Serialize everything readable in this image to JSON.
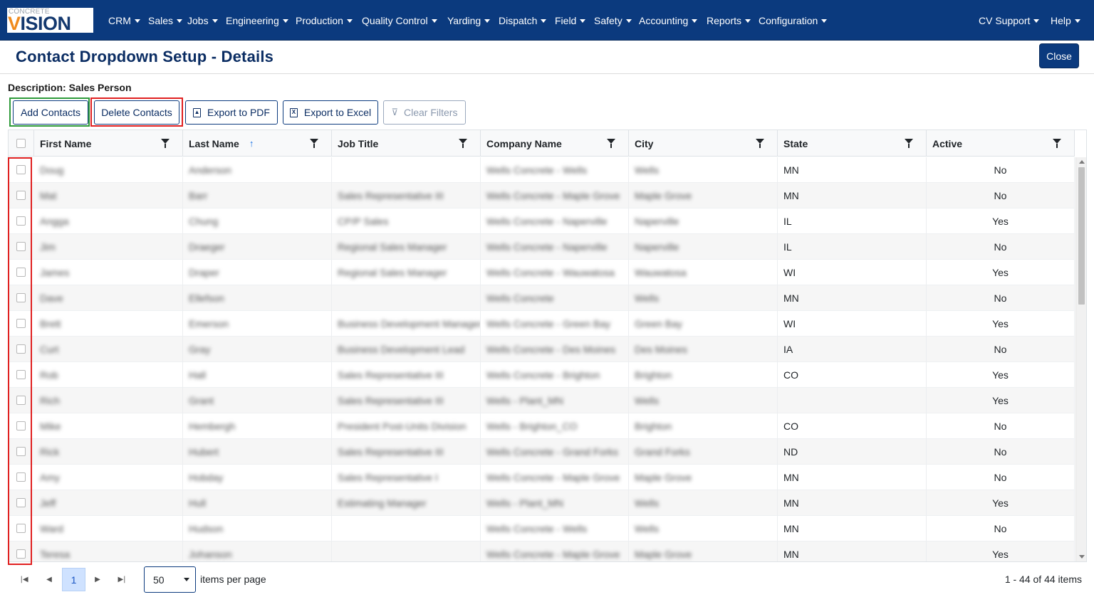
{
  "app": {
    "logo_top": "CONCRETE",
    "logo_brand": "VISION",
    "logo_brand_lead": "V",
    "logo_brand_rest": "ISION"
  },
  "nav": {
    "items": [
      "CRM",
      "Sales",
      "Jobs",
      "Engineering",
      "Production",
      "Quality Control",
      "Yarding",
      "Dispatch",
      "Field",
      "Safety",
      "Accounting",
      "Reports",
      "Configuration"
    ],
    "right_items": [
      "CV Support",
      "Help"
    ]
  },
  "page": {
    "title": "Contact Dropdown Setup - Details",
    "close_label": "Close",
    "description": "Description: Sales Person"
  },
  "toolbar": {
    "add_label": "Add Contacts",
    "delete_label": "Delete Contacts",
    "pdf_label": "Export to PDF",
    "excel_label": "Export to Excel",
    "clear_label": "Clear Filters"
  },
  "grid": {
    "columns": [
      "First Name",
      "Last Name",
      "Job Title",
      "Company Name",
      "City",
      "State",
      "Active"
    ],
    "sorted_column": "Last Name",
    "sort_direction": "ascending",
    "rows": [
      {
        "first": "Doug",
        "last": "Anderson",
        "title": "",
        "company": "Wells Concrete - Wells",
        "city": "Wells",
        "state": "MN",
        "active": "No"
      },
      {
        "first": "Mat",
        "last": "Barr",
        "title": "Sales Representative III",
        "company": "Wells Concrete - Maple Grove",
        "city": "Maple Grove",
        "state": "MN",
        "active": "No"
      },
      {
        "first": "Angga",
        "last": "Chung",
        "title": "CP/P Sales",
        "company": "Wells Concrete - Naperville",
        "city": "Naperville",
        "state": "IL",
        "active": "Yes"
      },
      {
        "first": "Jim",
        "last": "Draeger",
        "title": "Regional Sales Manager",
        "company": "Wells Concrete - Naperville",
        "city": "Naperville",
        "state": "IL",
        "active": "No"
      },
      {
        "first": "James",
        "last": "Draper",
        "title": "Regional Sales Manager",
        "company": "Wells Concrete - Wauwatosa",
        "city": "Wauwatosa",
        "state": "WI",
        "active": "Yes"
      },
      {
        "first": "Dave",
        "last": "Ellefson",
        "title": "",
        "company": "Wells Concrete",
        "city": "Wells",
        "state": "MN",
        "active": "No"
      },
      {
        "first": "Brett",
        "last": "Emerson",
        "title": "Business Development Manager",
        "company": "Wells Concrete - Green Bay",
        "city": "Green Bay",
        "state": "WI",
        "active": "Yes"
      },
      {
        "first": "Curt",
        "last": "Gray",
        "title": "Business Development Lead",
        "company": "Wells Concrete - Des Moines",
        "city": "Des Moines",
        "state": "IA",
        "active": "No"
      },
      {
        "first": "Rob",
        "last": "Hall",
        "title": "Sales Representative III",
        "company": "Wells Concrete - Brighton",
        "city": "Brighton",
        "state": "CO",
        "active": "Yes"
      },
      {
        "first": "Rich",
        "last": "Grant",
        "title": "Sales Representative III",
        "company": "Wells - Plant_MN",
        "city": "Wells",
        "state": "",
        "active": "Yes"
      },
      {
        "first": "Mike",
        "last": "Hembergh",
        "title": "President Post-Units Division",
        "company": "Wells - Brighton_CO",
        "city": "Brighton",
        "state": "CO",
        "active": "No"
      },
      {
        "first": "Rick",
        "last": "Hubert",
        "title": "Sales Representative III",
        "company": "Wells Concrete - Grand Forks",
        "city": "Grand Forks",
        "state": "ND",
        "active": "No"
      },
      {
        "first": "Amy",
        "last": "Hobday",
        "title": "Sales Representative I",
        "company": "Wells Concrete - Maple Grove",
        "city": "Maple Grove",
        "state": "MN",
        "active": "No"
      },
      {
        "first": "Jeff",
        "last": "Hull",
        "title": "Estimating Manager",
        "company": "Wells - Plant_MN",
        "city": "Wells",
        "state": "MN",
        "active": "Yes"
      },
      {
        "first": "Ward",
        "last": "Hudson",
        "title": "",
        "company": "Wells Concrete - Wells",
        "city": "Wells",
        "state": "MN",
        "active": "No"
      },
      {
        "first": "Teresa",
        "last": "Johanson",
        "title": "",
        "company": "Wells Concrete - Maple Grove",
        "city": "Maple Grove",
        "state": "MN",
        "active": "Yes"
      }
    ]
  },
  "pager": {
    "current_page": "1",
    "page_size": "50",
    "per_page_label": "items per page",
    "info": "1 - 44 of 44 items"
  }
}
